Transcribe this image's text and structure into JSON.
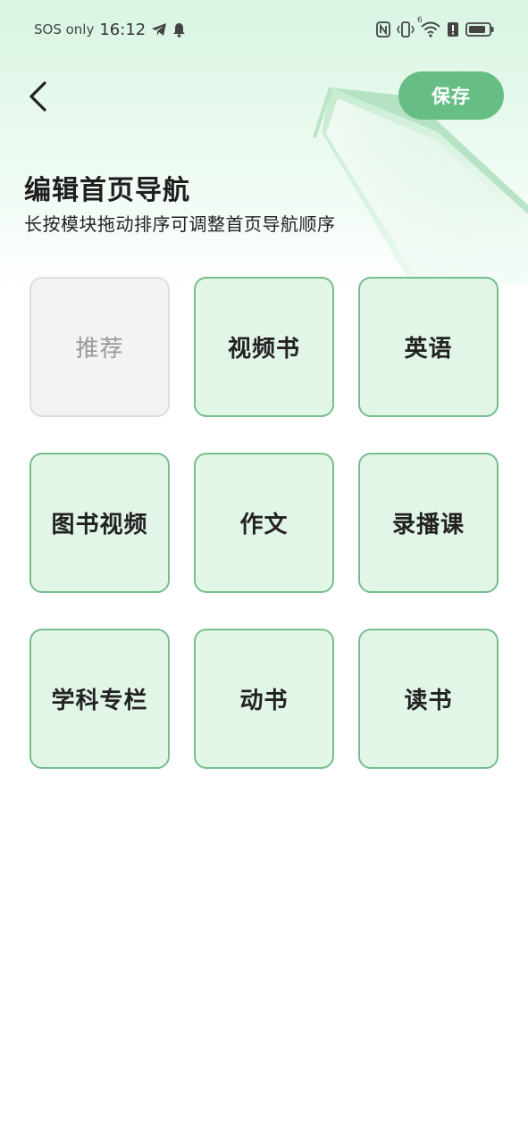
{
  "status_bar": {
    "carrier": "SOS only",
    "time": "16:12",
    "left_icons": [
      "telegram-icon",
      "bell-icon"
    ],
    "right_icons": [
      "nfc-icon",
      "vibrate-icon",
      "wifi-icon",
      "alert-icon",
      "battery-icon"
    ],
    "wifi_badge": "6"
  },
  "header": {
    "back_icon": "chevron-left-icon",
    "save_label": "保存"
  },
  "page": {
    "title": "编辑首页导航",
    "subtitle": "长按模块拖动排序可调整首页导航顺序"
  },
  "modules": [
    {
      "label": "推荐",
      "fixed": true
    },
    {
      "label": "视频书",
      "fixed": false
    },
    {
      "label": "英语",
      "fixed": false
    },
    {
      "label": "图书视频",
      "fixed": false
    },
    {
      "label": "作文",
      "fixed": false
    },
    {
      "label": "录播课",
      "fixed": false
    },
    {
      "label": "学科专栏",
      "fixed": false
    },
    {
      "label": "动书",
      "fixed": false
    },
    {
      "label": "读书",
      "fixed": false
    }
  ],
  "colors": {
    "accent": "#67be84",
    "tile_bg": "#e2f6e8",
    "tile_border": "#74bf8c",
    "fixed_tile_bg": "#f3f3f3",
    "fixed_tile_text": "#999999"
  }
}
